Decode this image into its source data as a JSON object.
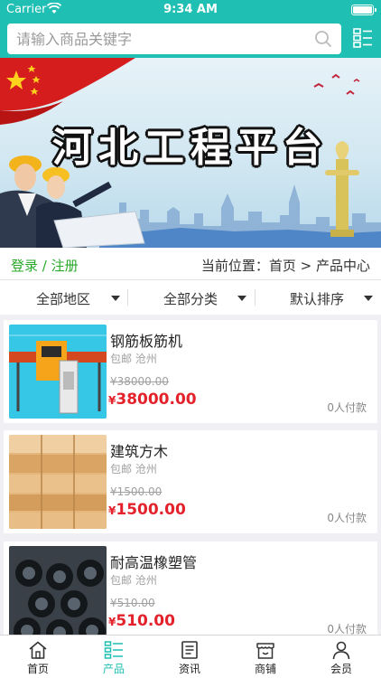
{
  "status_bar": {
    "carrier": "Carrier",
    "time": "9:34 AM"
  },
  "search": {
    "placeholder": "请输入商品关键字"
  },
  "banner": {
    "title": "河北工程平台"
  },
  "auth": {
    "login": "登录",
    "separator": " / ",
    "register": "注册"
  },
  "breadcrumb": {
    "text": "当前位置：首页 > 产品中心"
  },
  "filters": [
    {
      "label": "全部地区"
    },
    {
      "label": "全部分类"
    },
    {
      "label": "默认排序"
    }
  ],
  "products": [
    {
      "name": "钢筋板筋机",
      "shipping": "包邮",
      "location": "沧州",
      "old_price": "¥38000.00",
      "currency": "¥",
      "price": "38000.00",
      "paid": "0人付款"
    },
    {
      "name": "建筑方木",
      "shipping": "包邮",
      "location": "沧州",
      "old_price": "¥1500.00",
      "currency": "¥",
      "price": "1500.00",
      "paid": "0人付款"
    },
    {
      "name": "耐高温橡塑管",
      "shipping": "包邮",
      "location": "沧州",
      "old_price": "¥510.00",
      "currency": "¥",
      "price": "510.00",
      "paid": "0人付款"
    }
  ],
  "tabs": [
    {
      "label": "首页",
      "icon": "home-icon",
      "active": false
    },
    {
      "label": "产品",
      "icon": "products-icon",
      "active": true
    },
    {
      "label": "资讯",
      "icon": "news-icon",
      "active": false
    },
    {
      "label": "商铺",
      "icon": "shop-icon",
      "active": false
    },
    {
      "label": "会员",
      "icon": "member-icon",
      "active": false
    }
  ],
  "colors": {
    "primary": "#1fbfb3",
    "price": "#e3222b",
    "login": "#2aa82a",
    "background": "#efeff4"
  }
}
